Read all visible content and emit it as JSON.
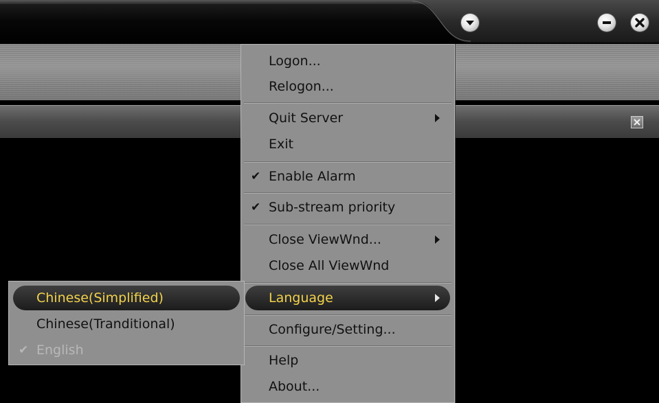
{
  "titlebar": {
    "menu_icon": "chevron-down-icon",
    "minimize_icon": "minimize-icon",
    "close_icon": "close-icon"
  },
  "panel": {
    "close_icon": "close-icon"
  },
  "main_menu": {
    "items": [
      {
        "label": "Logon...",
        "check": "",
        "submenu": false
      },
      {
        "label": "Relogon...",
        "check": "",
        "submenu": false
      },
      {
        "label": "Quit Server",
        "check": "",
        "submenu": true
      },
      {
        "label": "Exit",
        "check": "",
        "submenu": false
      },
      {
        "label": "Enable Alarm",
        "check": "✔",
        "submenu": false
      },
      {
        "label": "Sub-stream priority",
        "check": "✔",
        "submenu": false
      },
      {
        "label": "Close ViewWnd...",
        "check": "",
        "submenu": true
      },
      {
        "label": "Close All ViewWnd",
        "check": "",
        "submenu": false
      },
      {
        "label": "Language",
        "check": "",
        "submenu": true,
        "highlighted": true
      },
      {
        "label": "Configure/Setting...",
        "check": "",
        "submenu": false
      },
      {
        "label": "Help",
        "check": "",
        "submenu": false
      },
      {
        "label": "About...",
        "check": "",
        "submenu": false
      }
    ]
  },
  "language_menu": {
    "items": [
      {
        "label": "Chinese(Simplified)",
        "check": "",
        "highlighted": true
      },
      {
        "label": "Chinese(Tranditional)",
        "check": ""
      },
      {
        "label": "English",
        "check": "✔",
        "disabled": true
      }
    ]
  },
  "colors": {
    "highlight_text": "#f2d24a",
    "menu_background": "#8f8f8f",
    "disabled_text": "#b8b8b8"
  }
}
